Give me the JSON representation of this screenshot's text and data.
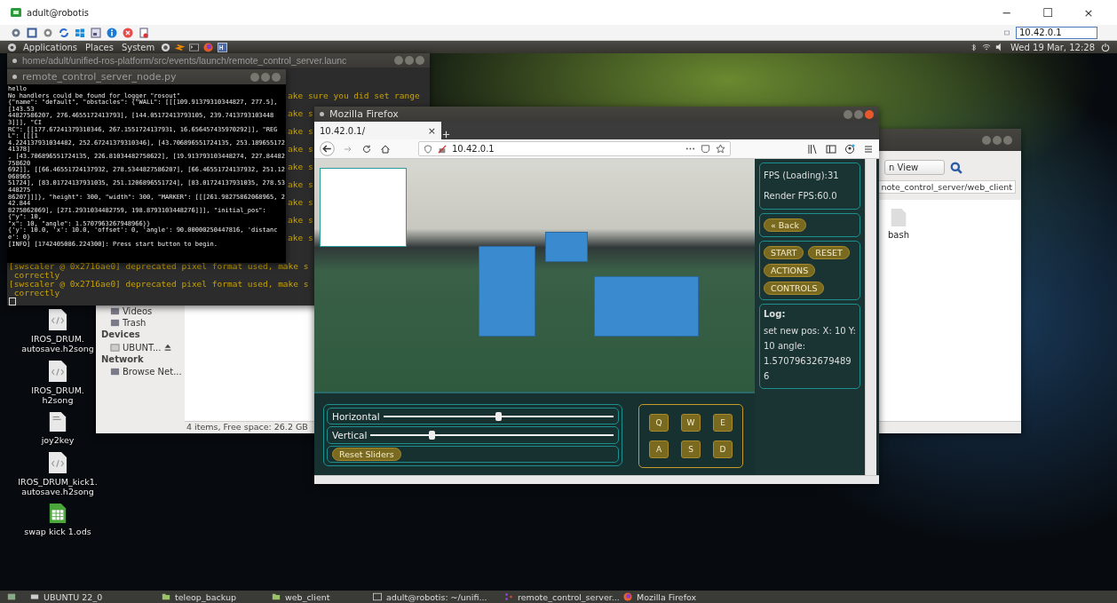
{
  "viewer": {
    "title": "adult@robotis",
    "address": "10.42.0.1",
    "window_controls": [
      "−",
      "☐",
      "×"
    ]
  },
  "panel": {
    "menus": [
      "Applications",
      "Places",
      "System"
    ],
    "clock": "Wed 19 Mar, 12:28"
  },
  "back_terminal": {
    "title": "home/adult/unified-ros-platform/src/events/launch/remote_control_server.launc",
    "partial_lines": [
      "ake sure you did set range",
      "ake s",
      "ake s",
      "ake s",
      "ake s",
      "ake s",
      "ake s",
      "ake s",
      "ake s"
    ],
    "lines": [
      "[swscaler @ 0x2716ae0] deprecated pixel format used, make s",
      " correctly",
      "[swscaler @ 0x2716ae0] deprecated pixel format used, make s",
      " correctly"
    ]
  },
  "node_terminal": {
    "title": "remote_control_server_node.py",
    "lines": [
      "hello",
      "No handlers could be found for logger \"rosout\"",
      "{\"name\": \"default\", \"obstacles\": {\"WALL\": [[[109.91379310344827, 277.5], [143.53",
      "44827586207, 276.4655172413793], [144.05172413793105, 239.74137931034483]]], \"CI",
      "RC\": [[177.67241379310346, 267.1551724137931, 16.656457435970292]], \"REGL\": [[[1",
      "4.224137931034482, 252.67241379310346], [43.706896551724135, 253.18965517241378]",
      ", [43.706896551724135, 226.81034482758622], [19.913793103448274, 227.84482758620",
      "692]], [[66.46551724137932, 278.5344827586207], [66.46551724137932, 251.12068965",
      "51724], [83.01724137931035, 251.1206896551724], [83.01724137931035, 278.53448275",
      "86207]]]}, \"height\": 300, \"width\": 300, \"MARKER\": [[[261.98275862068965, 242.844",
      "8275862069], [271.2931034482759, 198.8793103448276]]], \"initial_pos\": {\"y\": 10,",
      "\"x\": 10, \"angle\": 1.5707963267948966}}",
      "{'y': 10.0, 'x': 10.0, 'offset': 0, 'angle': 90.00000250447816, 'distance': 0}",
      "[INFO] [1742405086.224300]: Press start button to begin."
    ]
  },
  "file_manager": {
    "view_mode": "n View",
    "path": "note_control_server/web_client",
    "sidebar": [
      {
        "kind": "item",
        "label": "Videos"
      },
      {
        "kind": "item",
        "label": "Trash"
      },
      {
        "kind": "heading",
        "label": "Devices"
      },
      {
        "kind": "drive",
        "label": "UBUNT..."
      },
      {
        "kind": "heading",
        "label": "Network"
      },
      {
        "kind": "item",
        "label": "Browse Net..."
      }
    ],
    "files": [
      "bash"
    ],
    "status": "4 items, Free space: 26.2 GB"
  },
  "desktop_icons": [
    {
      "kind": "code",
      "label": "IROS_DRUM.\nautosave.h2song"
    },
    {
      "kind": "code",
      "label": "IROS_DRUM.\nh2song"
    },
    {
      "kind": "text",
      "label": "joy2key"
    },
    {
      "kind": "code",
      "label": "IROS_DRUM_kick1.\nautosave.h2song"
    },
    {
      "kind": "sheet",
      "label": "swap kick 1.ods"
    }
  ],
  "firefox": {
    "title": "Mozilla Firefox",
    "tab": "10.42.0.1/",
    "tab_close": "×",
    "url": "10.42.0.1"
  },
  "app": {
    "sliders": [
      {
        "label": "Horizontal",
        "level": 0.5
      },
      {
        "label": "Vertical",
        "level": 0.25
      }
    ],
    "reset_button": "Reset Sliders",
    "keys": [
      "Q",
      "W",
      "E",
      "A",
      "S",
      "D"
    ],
    "stats": [
      "FPS (Loading):31",
      "Render FPS:60.0"
    ],
    "back_button": "« Back",
    "action_buttons": [
      "START",
      "RESET",
      "ACTIONS",
      "CONTROLS"
    ],
    "log_title": "Log:",
    "log_text": "set new pos: X: 10 Y: 10 angle: 1.570796326794896"
  },
  "taskbar": [
    {
      "kind": "drive",
      "label": "UBUNTU 22_0"
    },
    {
      "kind": "folder",
      "label": "teleop_backup"
    },
    {
      "kind": "folder",
      "label": "web_client"
    },
    {
      "kind": "terminal",
      "label": "adult@robotis: ~/unifi..."
    },
    {
      "kind": "ros",
      "label": "remote_control_server..."
    },
    {
      "kind": "browser",
      "label": "Mozilla Firefox"
    }
  ]
}
